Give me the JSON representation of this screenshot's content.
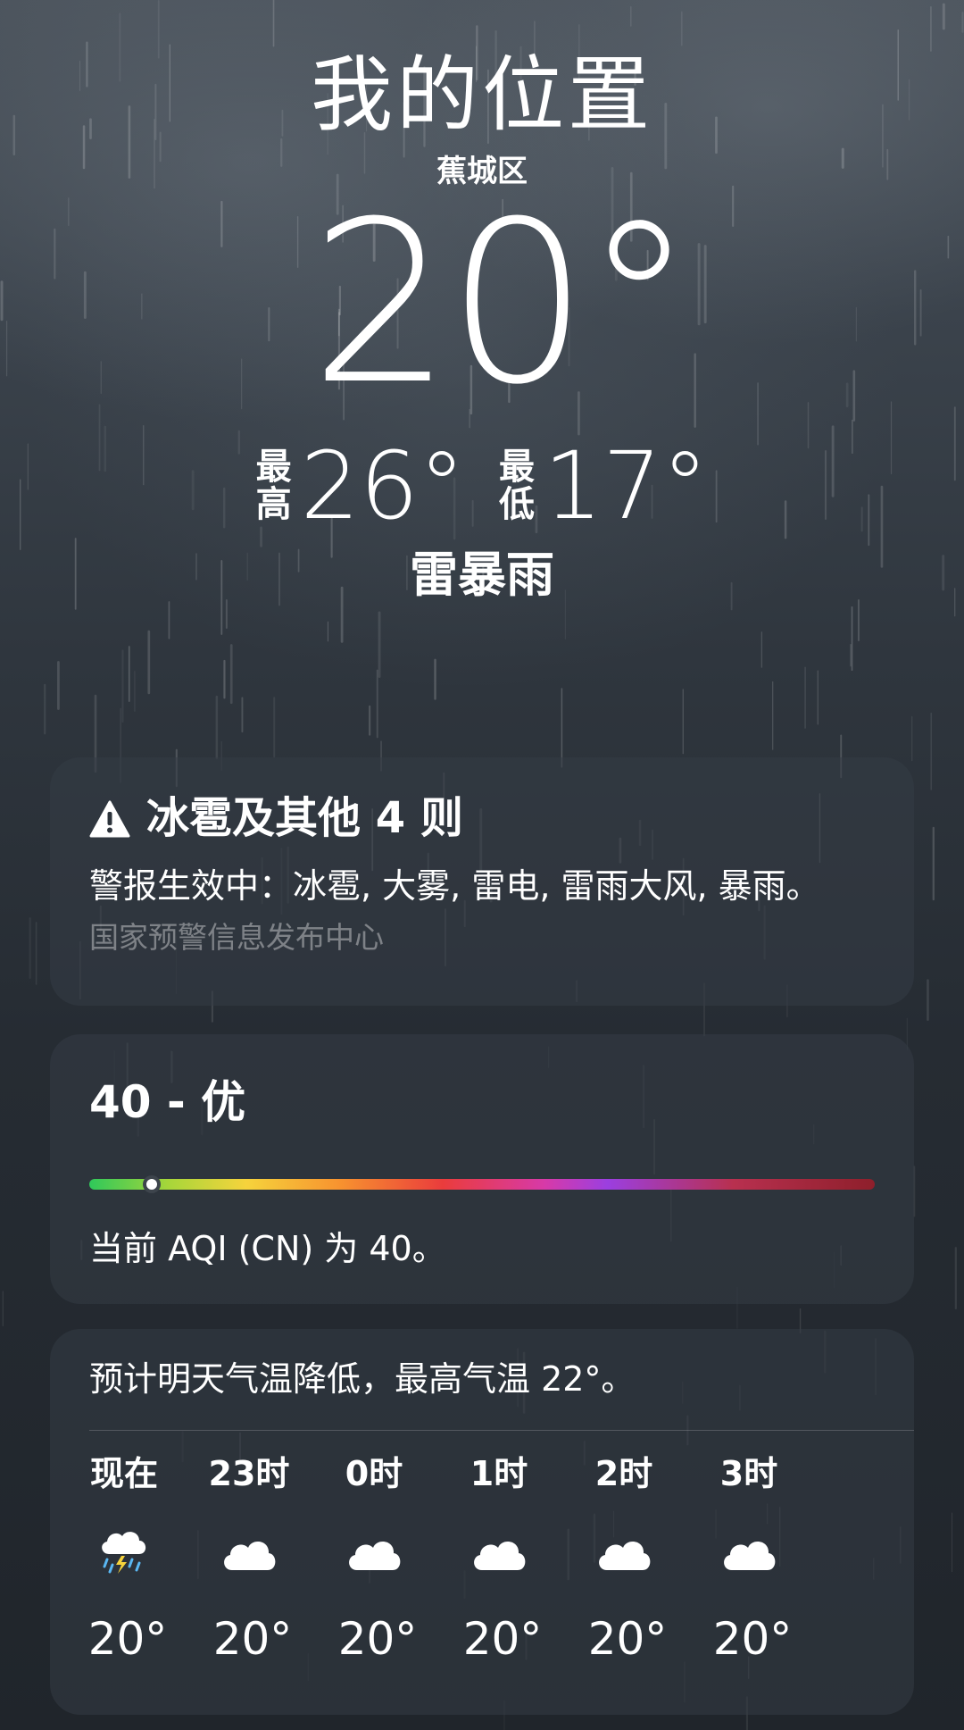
{
  "location": {
    "title": "我的位置",
    "subtitle": "蕉城区"
  },
  "current": {
    "temperature": "20°",
    "high_label": [
      "最",
      "高"
    ],
    "high": "26°",
    "low_label": [
      "最",
      "低"
    ],
    "low": "17°",
    "condition": "雷暴雨"
  },
  "alert": {
    "icon": "warning-triangle-icon",
    "title": "冰雹及其他 4 则",
    "body": "警报生效中：冰雹, 大雾, 雷电, 雷雨大风, 暴雨。",
    "source": "国家预警信息发布中心"
  },
  "aqi": {
    "value_text": "40 - 优",
    "value": 40,
    "level_fraction": 0.08,
    "description": "当前 AQI (CN) 为 40。"
  },
  "hourly": {
    "summary": "预计明天气温降低，最高气温 22°。",
    "items": [
      {
        "time": "现在",
        "icon": "thunderstorm-icon",
        "temp": "20°"
      },
      {
        "time": "23时",
        "icon": "cloud-icon",
        "temp": "20°"
      },
      {
        "time": "0时",
        "icon": "cloud-icon",
        "temp": "20°"
      },
      {
        "time": "1时",
        "icon": "cloud-icon",
        "temp": "20°"
      },
      {
        "time": "2时",
        "icon": "cloud-icon",
        "temp": "20°"
      },
      {
        "time": "3时",
        "icon": "cloud-icon",
        "temp": "20°"
      }
    ]
  }
}
